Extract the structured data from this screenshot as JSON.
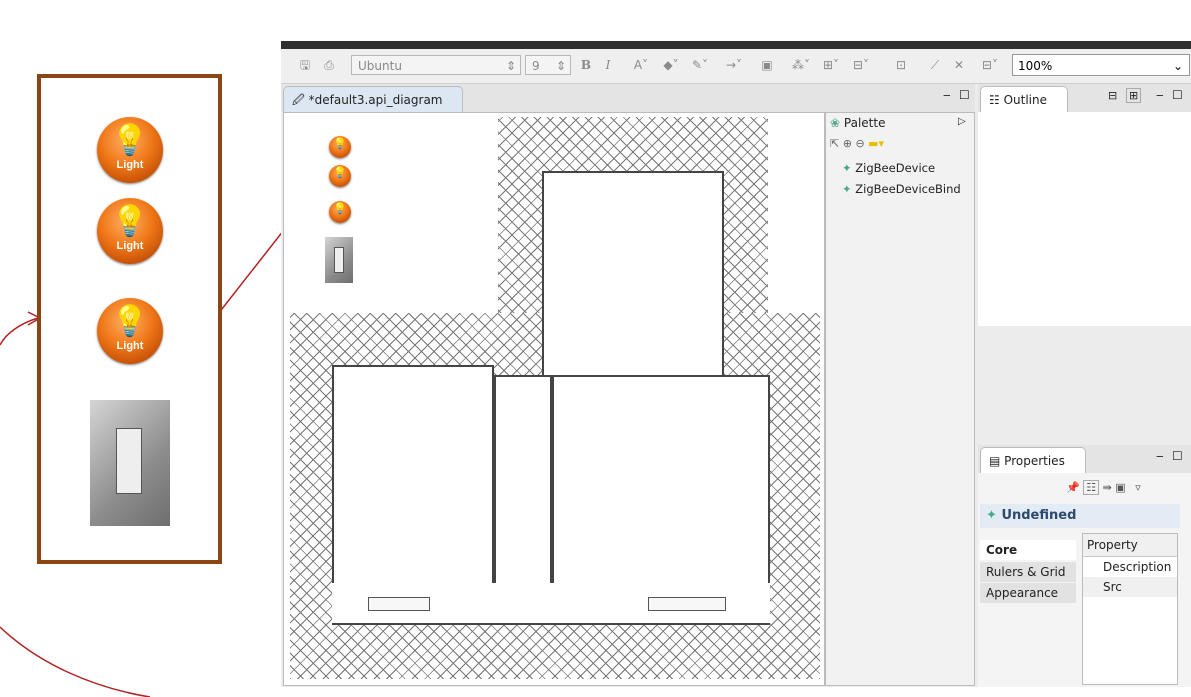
{
  "zoom_panel": {
    "bulb_label": "Light"
  },
  "toolbar": {
    "font_name": "Ubuntu",
    "font_size": "9",
    "bold": "B",
    "italic": "I",
    "zoom_value": "100%"
  },
  "editor": {
    "tab_label": "*default3.api_diagram",
    "tab_close": "⊠"
  },
  "palette": {
    "title": "Palette",
    "items": [
      "ZigBeeDevice",
      "ZigBeeDeviceBind"
    ]
  },
  "outline": {
    "title": "Outline",
    "close": "⊠"
  },
  "properties": {
    "title": "Properties",
    "close": "⊠",
    "heading": "Undefined",
    "tabs": [
      "Core",
      "Rulers & Grid",
      "Appearance"
    ],
    "column_header": "Property",
    "rows": [
      "Description",
      "Src"
    ]
  },
  "colors": {
    "frame": "#8b4513",
    "bulb": "#f07818",
    "annotation_line": "#b22222",
    "selected_tab": "#dde7f3"
  }
}
